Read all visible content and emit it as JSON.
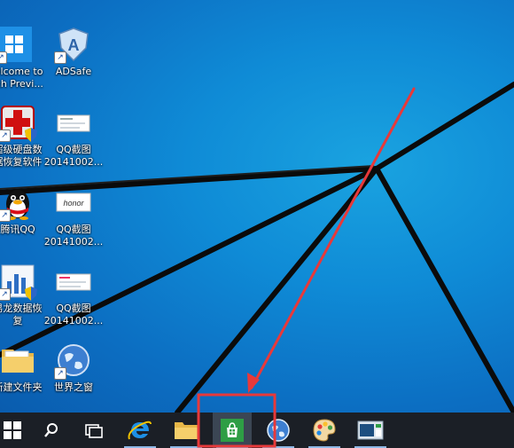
{
  "desktop": {
    "icons": [
      {
        "label": "Welcome to\nTech Previ...",
        "icon": "windows-tile-icon"
      },
      {
        "label": "ADSafe",
        "icon": "adsafe-shield-icon"
      },
      {
        "label": "超级硬盘数\n据恢复软件",
        "icon": "disk-recovery-icon"
      },
      {
        "label": "QQ截图\n20141002...",
        "icon": "screenshot-file-icon"
      },
      {
        "label": "腾讯QQ",
        "icon": "qq-penguin-icon"
      },
      {
        "label": "QQ截图\n20141002...",
        "icon": "honor-screenshot-icon"
      },
      {
        "label": "易龙数据恢\n复",
        "icon": "data-recovery-chart-icon"
      },
      {
        "label": "QQ截图\n20141002...",
        "icon": "screenshot-file-icon"
      },
      {
        "label": "新建文件夹",
        "icon": "folder-icon"
      },
      {
        "label": "世界之窗",
        "icon": "world-browser-icon"
      }
    ]
  },
  "taskbar": {
    "buttons": [
      {
        "name": "start-button",
        "icon": "windows-logo-icon"
      },
      {
        "name": "search-button",
        "icon": "search-icon"
      },
      {
        "name": "task-view-button",
        "icon": "task-view-icon"
      },
      {
        "name": "ie-button",
        "icon": "internet-explorer-icon"
      },
      {
        "name": "file-explorer-button",
        "icon": "folder-icon"
      },
      {
        "name": "store-button",
        "icon": "store-bag-icon"
      },
      {
        "name": "world-browser-button",
        "icon": "globe-icon"
      },
      {
        "name": "paint-button",
        "icon": "palette-icon"
      },
      {
        "name": "screen-app-button",
        "icon": "screen-window-icon"
      }
    ]
  },
  "colors": {
    "annotation": "#e8393a",
    "accent_store": "#2e9e45",
    "taskbar": "#1b1f26"
  }
}
